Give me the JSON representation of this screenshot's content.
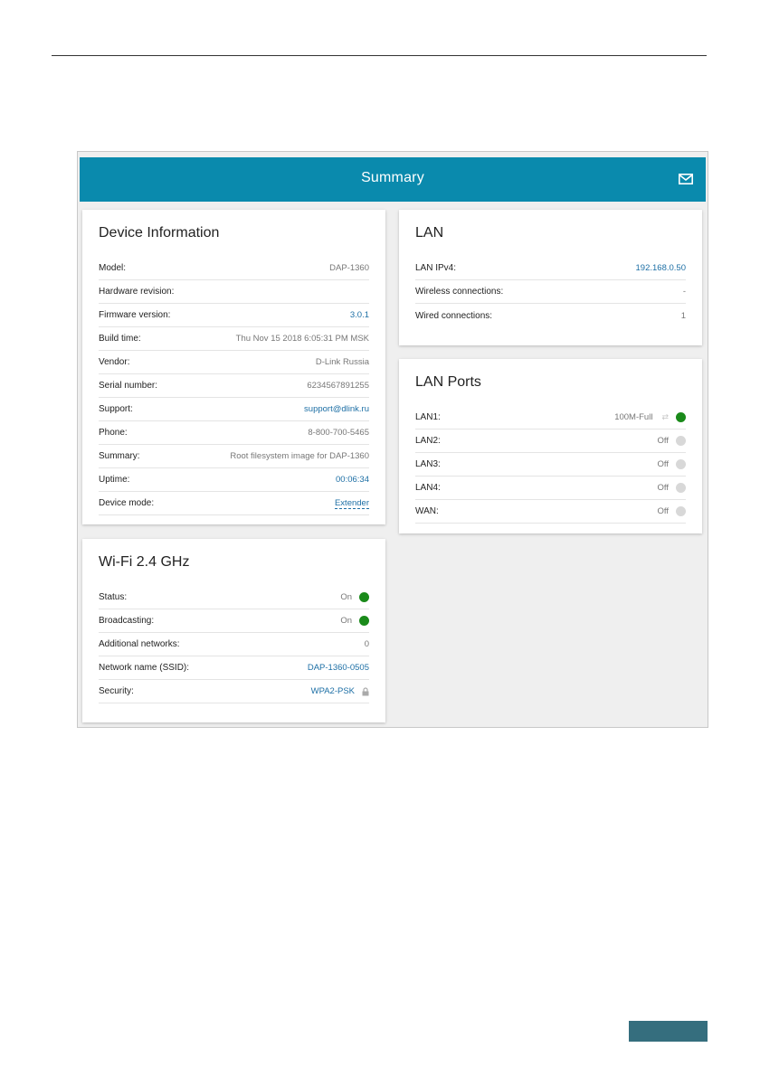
{
  "header": {
    "title": "Summary",
    "mail_icon": "mail-icon"
  },
  "device_info": {
    "title": "Device Information",
    "rows": [
      {
        "label": "Model:",
        "value": "DAP-1360"
      },
      {
        "label": "Hardware revision:",
        "value": ""
      },
      {
        "label": "Firmware version:",
        "value": "3.0.1"
      },
      {
        "label": "Build time:",
        "value": "Thu Nov 15 2018 6:05:31 PM MSK"
      },
      {
        "label": "Vendor:",
        "value": "D-Link Russia"
      },
      {
        "label": "Serial number:",
        "value": "6234567891255"
      },
      {
        "label": "Support:",
        "value": "support@dlink.ru"
      },
      {
        "label": "Phone:",
        "value": "8-800-700-5465"
      },
      {
        "label": "Summary:",
        "value": "Root filesystem image for DAP-1360"
      },
      {
        "label": "Uptime:",
        "value": "00:06:34"
      },
      {
        "label": "Device mode:",
        "value": "Extender"
      }
    ]
  },
  "wifi": {
    "title": "Wi-Fi 2.4 GHz",
    "rows": [
      {
        "label": "Status:",
        "value": "On",
        "indicator": "on"
      },
      {
        "label": "Broadcasting:",
        "value": "On",
        "indicator": "on"
      },
      {
        "label": "Additional networks:",
        "value": "0"
      },
      {
        "label": "Network name (SSID):",
        "value": "DAP-1360-0505"
      },
      {
        "label": "Security:",
        "value": "WPA2-PSK",
        "icon": "lock-icon"
      }
    ]
  },
  "lan": {
    "title": "LAN",
    "rows": [
      {
        "label": "LAN IPv4:",
        "value": "192.168.0.50"
      },
      {
        "label": "Wireless connections:",
        "value": "-"
      },
      {
        "label": "Wired connections:",
        "value": "1"
      }
    ]
  },
  "lan_ports": {
    "title": "LAN Ports",
    "rows": [
      {
        "label": "LAN1:",
        "value": "100M-Full",
        "indicator": "on",
        "icon": "duplex-arrows-icon"
      },
      {
        "label": "LAN2:",
        "value": "Off",
        "indicator": "off"
      },
      {
        "label": "LAN3:",
        "value": "Off",
        "indicator": "off"
      },
      {
        "label": "LAN4:",
        "value": "Off",
        "indicator": "off"
      },
      {
        "label": "WAN:",
        "value": "Off",
        "indicator": "off"
      }
    ]
  },
  "colors": {
    "header": "#0a8aad",
    "on": "#1a8a1a",
    "off": "#d8d8d8",
    "link": "#1d6fa5",
    "page_box": "#356e7e"
  }
}
